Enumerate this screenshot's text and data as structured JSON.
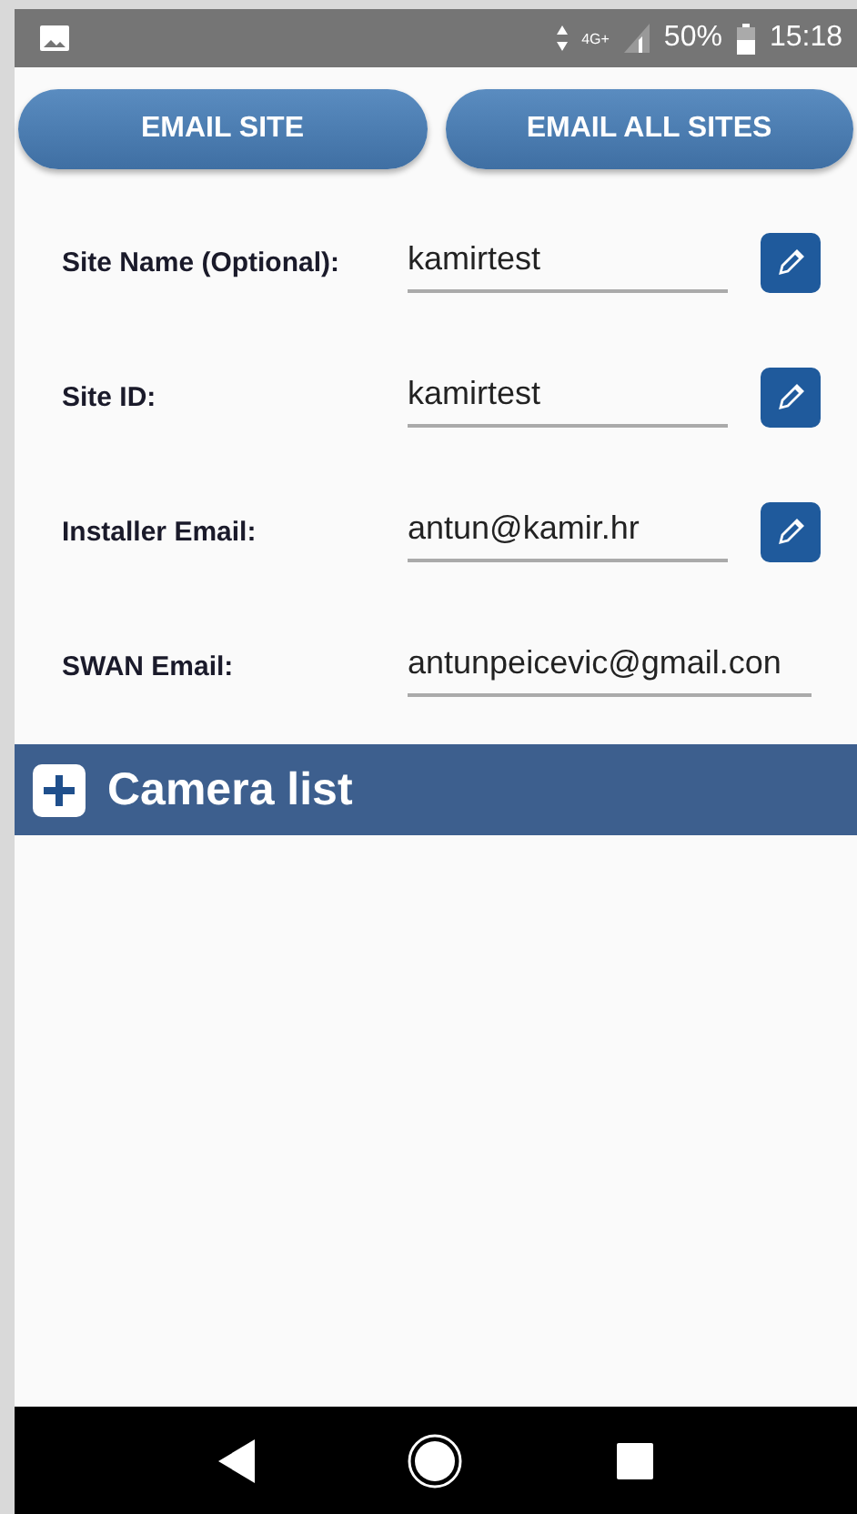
{
  "status_bar": {
    "network": "4G+",
    "battery": "50%",
    "time": "15:18"
  },
  "buttons": [
    "EMAIL SITE",
    "EMAIL ALL SITES"
  ],
  "fields": [
    {
      "label": "Site Name (Optional):",
      "value": "kamirtest",
      "editable": true
    },
    {
      "label": "Site ID:",
      "value": "kamirtest",
      "editable": true
    },
    {
      "label": "Installer Email:",
      "value": "antun@kamir.hr",
      "editable": true
    },
    {
      "label": "SWAN Email:",
      "value": "antunpeicevic@gmail.con",
      "editable": false
    }
  ],
  "section": {
    "title": "Camera list",
    "expanded": false
  }
}
